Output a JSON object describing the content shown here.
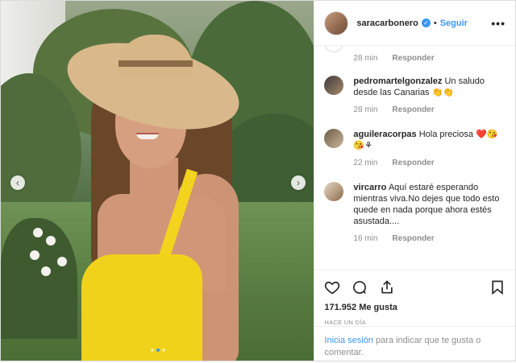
{
  "post": {
    "username": "saracarbonero",
    "follow_label": "Seguir",
    "more_label": "•••",
    "carousel": {
      "active_index": 1,
      "count": 3
    }
  },
  "comments": [
    {
      "user": "",
      "text": "",
      "time": "28 min",
      "reply": "Responder"
    },
    {
      "user": "pedromartelgonzalez",
      "text": "Un saludo desde las Canarias 👏👏",
      "time": "28 min",
      "reply": "Responder"
    },
    {
      "user": "aguileracorpas",
      "text": "Hola preciosa ❤️😘😘⚘",
      "time": "22 min",
      "reply": "Responder"
    },
    {
      "user": "vircarro",
      "text": "Aquí estaré esperando mientras viva.No dejes que todo esto quede en nada porque ahora estés asustada....",
      "time": "16 min",
      "reply": "Responder"
    }
  ],
  "footer": {
    "likes": "171.952 Me gusta",
    "when": "HACE UN DÍA",
    "login_link": "Inicia sesión",
    "login_text": " para indicar que te gusta o comentar."
  },
  "icons": {
    "like": "heart-icon",
    "comment": "comment-icon",
    "share": "share-icon",
    "save": "bookmark-icon",
    "verified": "verified-badge-icon"
  },
  "colors": {
    "accent": "#3897f0",
    "muted": "#8e8e8e",
    "text": "#262626",
    "swimsuit": "#f0d21a"
  }
}
